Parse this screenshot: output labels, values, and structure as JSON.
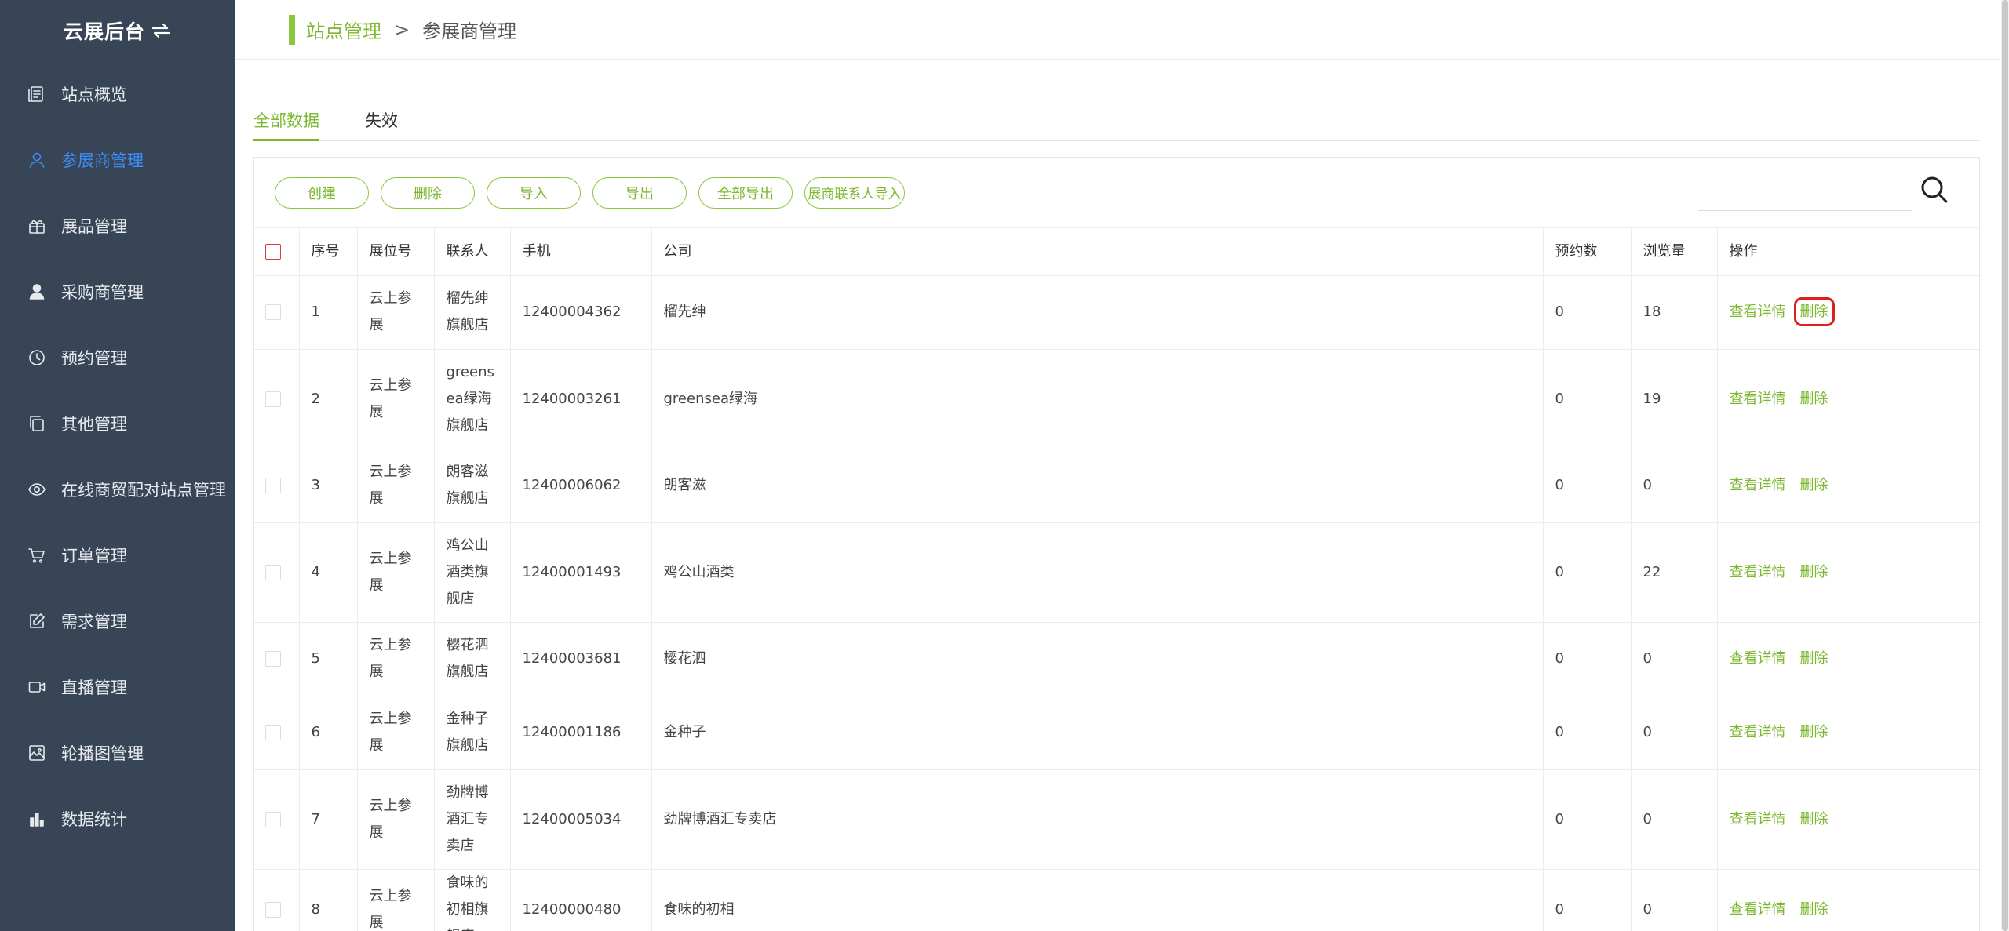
{
  "brand": {
    "title": "云展后台"
  },
  "sidebar": {
    "items": [
      {
        "label": "站点概览",
        "icon": "document-icon"
      },
      {
        "label": "参展商管理",
        "icon": "user-icon",
        "active": true
      },
      {
        "label": "展品管理",
        "icon": "gift-icon"
      },
      {
        "label": "采购商管理",
        "icon": "person-icon"
      },
      {
        "label": "预约管理",
        "icon": "clock-icon"
      },
      {
        "label": "其他管理",
        "icon": "copy-icon"
      },
      {
        "label": "在线商贸配对站点管理",
        "icon": "eye-icon"
      },
      {
        "label": "订单管理",
        "icon": "cart-icon"
      },
      {
        "label": "需求管理",
        "icon": "edit-icon"
      },
      {
        "label": "直播管理",
        "icon": "video-icon"
      },
      {
        "label": "轮播图管理",
        "icon": "image-icon"
      },
      {
        "label": "数据统计",
        "icon": "bar-chart-icon"
      }
    ]
  },
  "breadcrumb": {
    "parent": "站点管理",
    "separator": ">",
    "current": "参展商管理"
  },
  "tabs": [
    {
      "label": "全部数据"
    },
    {
      "label": "失效"
    }
  ],
  "toolbar": {
    "create": "创建",
    "delete": "删除",
    "import": "导入",
    "export": "导出",
    "export_all": "全部导出",
    "import_contacts": "展商联系人导入",
    "search_placeholder": ""
  },
  "table": {
    "headers": {
      "index": "序号",
      "booth": "展位号",
      "contact": "联系人",
      "phone": "手机",
      "company": "公司",
      "reservations": "预约数",
      "views": "浏览量",
      "actions": "操作"
    },
    "action_view": "查看详情",
    "action_delete": "删除",
    "rows": [
      {
        "index": "1",
        "booth": "云上参展",
        "contact": "榴先绅旗舰店",
        "phone": "12400004362",
        "company": "榴先绅",
        "reservations": "0",
        "views": "18"
      },
      {
        "index": "2",
        "booth": "云上参展",
        "contact": "greensea绿海旗舰店",
        "phone": "12400003261",
        "company": "greensea绿海",
        "reservations": "0",
        "views": "19"
      },
      {
        "index": "3",
        "booth": "云上参展",
        "contact": "朗客滋旗舰店",
        "phone": "12400006062",
        "company": "朗客滋",
        "reservations": "0",
        "views": "0"
      },
      {
        "index": "4",
        "booth": "云上参展",
        "contact": "鸡公山酒类旗舰店",
        "phone": "12400001493",
        "company": "鸡公山酒类",
        "reservations": "0",
        "views": "22"
      },
      {
        "index": "5",
        "booth": "云上参展",
        "contact": "樱花泗旗舰店",
        "phone": "12400003681",
        "company": "樱花泗",
        "reservations": "0",
        "views": "0"
      },
      {
        "index": "6",
        "booth": "云上参展",
        "contact": "金种子旗舰店",
        "phone": "12400001186",
        "company": "金种子",
        "reservations": "0",
        "views": "0"
      },
      {
        "index": "7",
        "booth": "云上参展",
        "contact": "劲牌博酒汇专卖店",
        "phone": "12400005034",
        "company": "劲牌博酒汇专卖店",
        "reservations": "0",
        "views": "0"
      },
      {
        "index": "8",
        "booth": "云上参展",
        "contact": "食味的初相旗舰店",
        "phone": "12400000480",
        "company": "食味的初相",
        "reservations": "0",
        "views": "0"
      }
    ]
  }
}
